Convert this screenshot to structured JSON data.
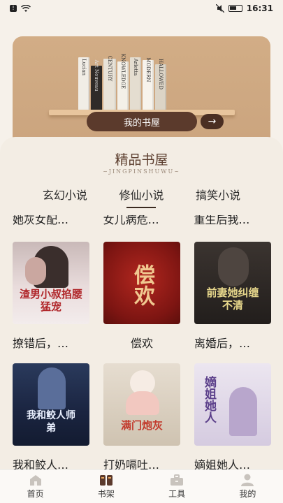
{
  "status": {
    "time": "16:31"
  },
  "banner": {
    "button_label": "我的书屋",
    "arrow": "→",
    "spines": [
      "Lucian",
      "Art Nouveau",
      "CENTURY",
      "KNOWLEDGE",
      "Arletta",
      "MODERN",
      "HALLOWED"
    ]
  },
  "section": {
    "title": "精品书屋",
    "subtitle": "~JINGPINSHUWU~"
  },
  "tabs": [
    {
      "label": "玄幻小说",
      "active": false
    },
    {
      "label": "修仙小说",
      "active": true
    },
    {
      "label": "搞笑小说",
      "active": false
    }
  ],
  "cut_row": [
    "她灰女配…",
    "女儿病危…",
    "重生后我…"
  ],
  "books": [
    {
      "title": "撩错后，…",
      "cover_text": "渣男小叔掐腰猛宠",
      "cover_color": "#f0e6e6",
      "align": "left"
    },
    {
      "title": "偿欢",
      "cover_text": "偿欢",
      "cover_color": "#8f1c18",
      "align": "center"
    },
    {
      "title": "离婚后，…",
      "cover_text": "前妻她纠缠不清",
      "cover_color": "#2a2623",
      "align": "left"
    },
    {
      "title": "我和鲛人…",
      "cover_text": "我和鲛人师弟",
      "cover_color": "#1e2a44",
      "align": "left"
    },
    {
      "title": "打奶嗝吐…",
      "cover_text": "满门炮灰",
      "cover_color": "#d9cfbf",
      "align": "left"
    },
    {
      "title": "嫡姐她人…",
      "cover_text": "嫡姐她人",
      "cover_color": "#d8d0e4",
      "align": "left"
    }
  ],
  "nav": [
    {
      "label": "首页",
      "icon": "home-icon",
      "active": false
    },
    {
      "label": "书架",
      "icon": "bookshelf-icon",
      "active": true
    },
    {
      "label": "工具",
      "icon": "toolbox-icon",
      "active": false
    },
    {
      "label": "我的",
      "icon": "person-icon",
      "active": false
    }
  ],
  "colors": {
    "accent": "#5b3a2c",
    "panel": "#f3ede4",
    "banner": "#cfa982"
  }
}
